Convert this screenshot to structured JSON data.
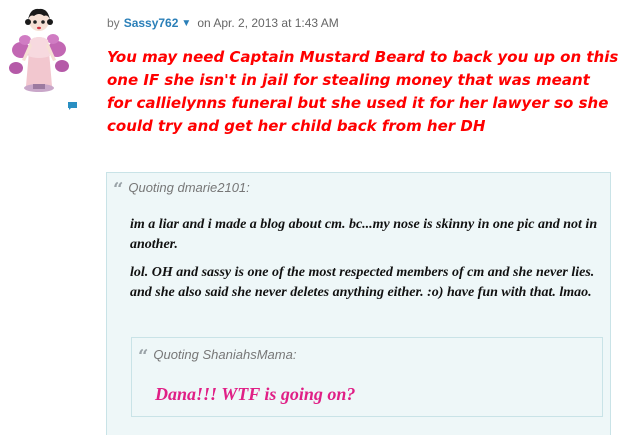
{
  "post": {
    "author_prefix": "by",
    "author": "Sassy762",
    "author_menu_icon": "chevron-down-icon",
    "date": "on Apr. 2, 2013 at 1:43 AM",
    "body": "You may need Captain Mustard Beard to back you up on this one IF she isn't in jail for stealing money that was meant for callielynns funeral but she used it for her lawyer so she could try and get her child back from her DH",
    "body_color": "#ff0000",
    "avatar_icon": "betty-boop-avatar-icon",
    "comment_icon": "comment-bubble-icon"
  },
  "quote_outer": {
    "icon": "quote-mark-icon",
    "header": "Quoting dmarie2101:",
    "paragraphs": [
      "im a liar and i made a blog about cm. bc...my nose is skinny in one pic and not in another.",
      "lol. OH and sassy is one of  the most respected members of cm and she never lies. and she also said she never deletes anything either. :o) have fun with that. lmao."
    ]
  },
  "quote_inner": {
    "icon": "quote-mark-icon",
    "header": "Quoting ShaniahsMama:",
    "text": "Dana!!! WTF is going on?",
    "text_color": "#e01f86"
  },
  "colors": {
    "author_link": "#2a7fb8",
    "quote_bg": "#eef7f8",
    "quote_border": "#c9e3e7"
  }
}
